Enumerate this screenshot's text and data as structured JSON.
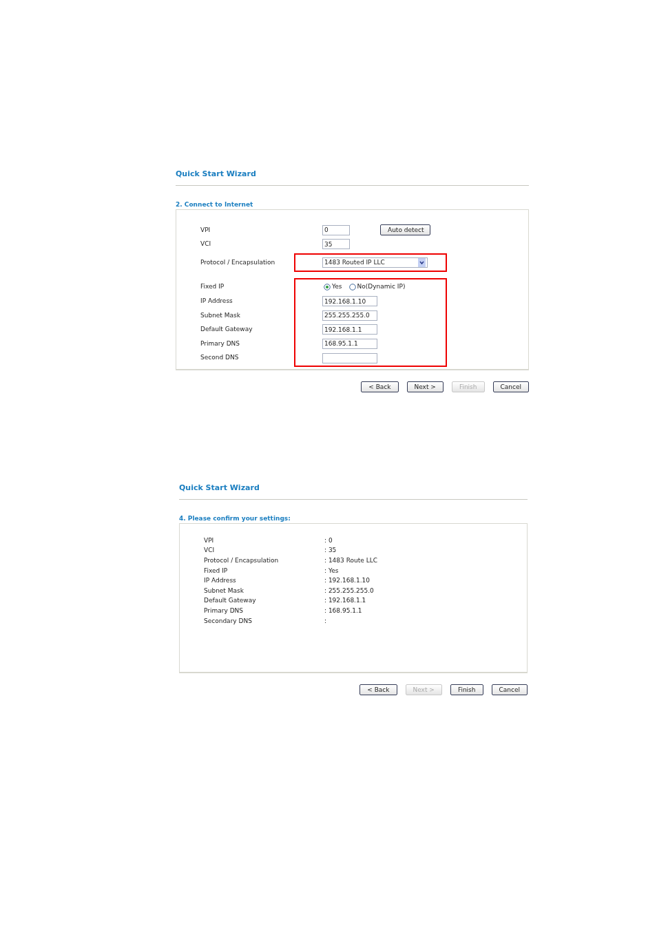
{
  "wizard_step_form": {
    "title": "Quick Start Wizard",
    "section": "2. Connect to Internet",
    "groups": [
      {
        "highlighted": false,
        "rows": [
          {
            "kind": "short_input",
            "label": "VPI",
            "value": "0",
            "action": "Auto detect"
          },
          {
            "kind": "short_input",
            "label": "VCI",
            "value": "35"
          }
        ]
      },
      {
        "highlighted": true,
        "rows": [
          {
            "kind": "select",
            "label": "Protocol / Encapsulation",
            "value": "1483 Routed IP LLC"
          }
        ]
      },
      {
        "highlighted": true,
        "rows": [
          {
            "kind": "radio",
            "label": "Fixed IP",
            "options": [
              {
                "label": "Yes",
                "selected": true
              },
              {
                "label": "No(Dynamic IP)",
                "selected": false
              }
            ]
          },
          {
            "kind": "input",
            "label": "IP Address",
            "value": "192.168.1.10"
          },
          {
            "kind": "input",
            "label": "Subnet Mask",
            "value": "255.255.255.0"
          },
          {
            "kind": "input",
            "label": "Default Gateway",
            "value": "192.168.1.1"
          },
          {
            "kind": "input",
            "label": "Primary DNS",
            "value": "168.95.1.1"
          },
          {
            "kind": "input",
            "label": "Second DNS"
          }
        ]
      }
    ],
    "buttons": [
      {
        "label": "< Back",
        "disabled": false
      },
      {
        "label": "Next >",
        "disabled": false
      },
      {
        "label": "Finish",
        "disabled": true
      },
      {
        "label": "Cancel",
        "disabled": false
      }
    ]
  },
  "wizard_confirm": {
    "title": "Quick Start Wizard",
    "section": "4. Please confirm your settings:",
    "rows": [
      {
        "label": "VPI",
        "value": ": 0"
      },
      {
        "label": "VCI",
        "value": ": 35"
      },
      {
        "label": "Protocol / Encapsulation",
        "value": ": 1483 Route LLC"
      },
      {
        "label": "Fixed IP",
        "value": ": Yes"
      },
      {
        "label": "IP Address",
        "value": ": 192.168.1.10"
      },
      {
        "label": "Subnet Mask",
        "value": ": 255.255.255.0"
      },
      {
        "label": "Default Gateway",
        "value": ": 192.168.1.1"
      },
      {
        "label": "Primary DNS",
        "value": ": 168.95.1.1"
      },
      {
        "label": "Secondary DNS",
        "value": ":"
      }
    ],
    "buttons": [
      {
        "label": "< Back",
        "disabled": false
      },
      {
        "label": "Next >",
        "disabled": true
      },
      {
        "label": "Finish",
        "disabled": false
      },
      {
        "label": "Cancel",
        "disabled": false
      }
    ]
  }
}
